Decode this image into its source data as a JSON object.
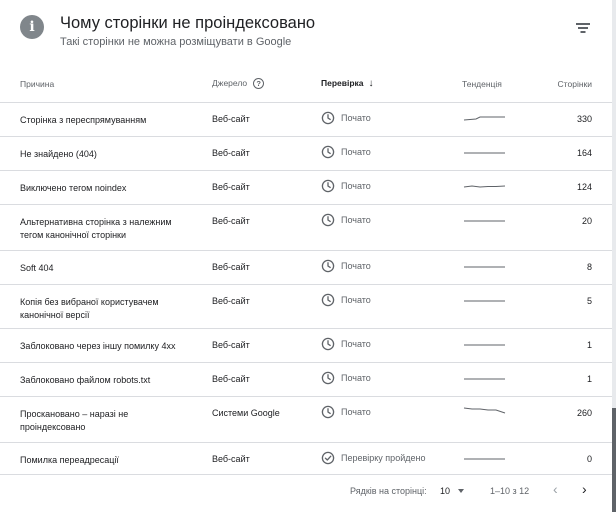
{
  "header": {
    "title": "Чому сторінки не проіндексовано",
    "subtitle": "Такі сторінки не можна розміщувати в Google",
    "info_icon_glyph": "i"
  },
  "table": {
    "columns": {
      "reason": "Причина",
      "source": "Джерело",
      "validation": "Перевірка",
      "trend": "Тенденція",
      "pages": "Сторінки"
    },
    "rows": [
      {
        "reason": "Сторінка з переспрямуванням",
        "source": "Веб-сайт",
        "status": "Почато",
        "status_icon": "clock-icon",
        "pages": "330",
        "trend": "slight-rise"
      },
      {
        "reason": "Не знайдено (404)",
        "source": "Веб-сайт",
        "status": "Почато",
        "status_icon": "clock-icon",
        "pages": "164",
        "trend": "flat"
      },
      {
        "reason": "Виключено тегом noindex",
        "source": "Веб-сайт",
        "status": "Почато",
        "status_icon": "clock-icon",
        "pages": "124",
        "trend": "wave"
      },
      {
        "reason": "Альтернативна сторінка з належним тегом канонічної сторінки",
        "source": "Веб-сайт",
        "status": "Почато",
        "status_icon": "clock-icon",
        "pages": "20",
        "trend": "flat"
      },
      {
        "reason": "Soft 404",
        "source": "Веб-сайт",
        "status": "Почато",
        "status_icon": "clock-icon",
        "pages": "8",
        "trend": "flat"
      },
      {
        "reason": "Копія без вибраної користувачем канонічної версії",
        "source": "Веб-сайт",
        "status": "Почато",
        "status_icon": "clock-icon",
        "pages": "5",
        "trend": "flat"
      },
      {
        "reason": "Заблоковано через іншу помилку 4xx",
        "source": "Веб-сайт",
        "status": "Почато",
        "status_icon": "clock-icon",
        "pages": "1",
        "trend": "flat"
      },
      {
        "reason": "Заблоковано файлом robots.txt",
        "source": "Веб-сайт",
        "status": "Почато",
        "status_icon": "clock-icon",
        "pages": "1",
        "trend": "flat"
      },
      {
        "reason": "Проскановано – наразі не проіндексовано",
        "source": "Системи Google",
        "status": "Почато",
        "status_icon": "clock-icon",
        "pages": "260",
        "trend": "decline"
      },
      {
        "reason": "Помилка переадресації",
        "source": "Веб-сайт",
        "status": "Перевірку пройдено",
        "status_icon": "check-circle-icon",
        "pages": "0",
        "trend": "flat"
      }
    ]
  },
  "pagination": {
    "rows_per_page_label": "Рядків на сторінці:",
    "rows_per_page_value": "10",
    "range": "1–10 з 12",
    "prev_glyph": "‹",
    "next_glyph": "›"
  },
  "colors": {
    "text": "#202124",
    "secondary": "#5f6368",
    "divider": "#dadce0",
    "icon_gray": "#80868b"
  }
}
